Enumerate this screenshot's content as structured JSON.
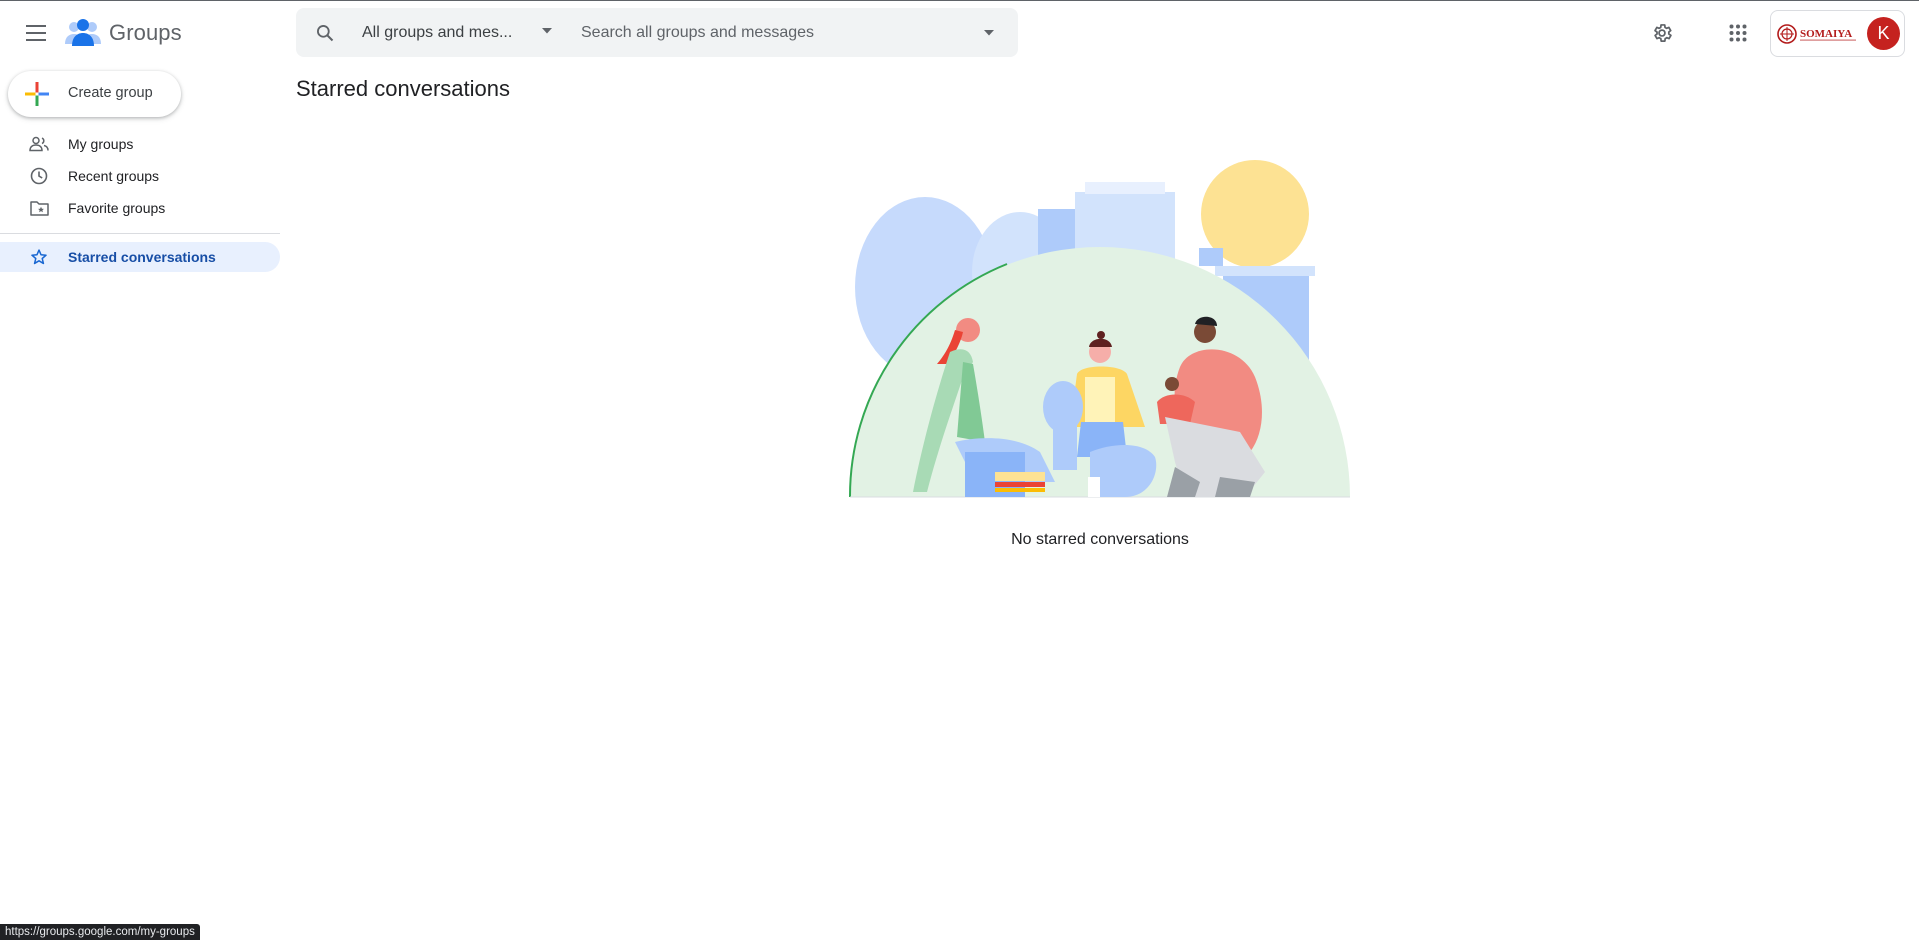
{
  "app": {
    "name": "Groups",
    "menu_icon": "hamburger-menu-icon",
    "logo_icon": "groups-people-icon"
  },
  "search": {
    "scope_label": "All groups and mes...",
    "placeholder": "Search all groups and messages",
    "value": ""
  },
  "header": {
    "settings_icon": "gear-icon",
    "apps_icon": "apps-grid-icon",
    "account": {
      "org_logo_text": "SOMAIYA",
      "avatar_initial": "K"
    }
  },
  "sidebar": {
    "create_label": "Create group",
    "items": [
      {
        "label": "My groups",
        "icon": "people-icon",
        "active": false
      },
      {
        "label": "Recent groups",
        "icon": "clock-icon",
        "active": false
      },
      {
        "label": "Favorite groups",
        "icon": "folder-star-icon",
        "active": false
      },
      {
        "label": "Starred conversations",
        "icon": "star-icon",
        "active": true
      }
    ]
  },
  "main": {
    "title": "Starred conversations",
    "empty_message": "No starred conversations"
  },
  "status_bar": {
    "url": "https://groups.google.com/my-groups"
  },
  "colors": {
    "accent": "#1a73e8",
    "active_bg": "#e8f0fe",
    "avatar_bg": "#c5221f",
    "brand_red": "#b31b1b"
  }
}
